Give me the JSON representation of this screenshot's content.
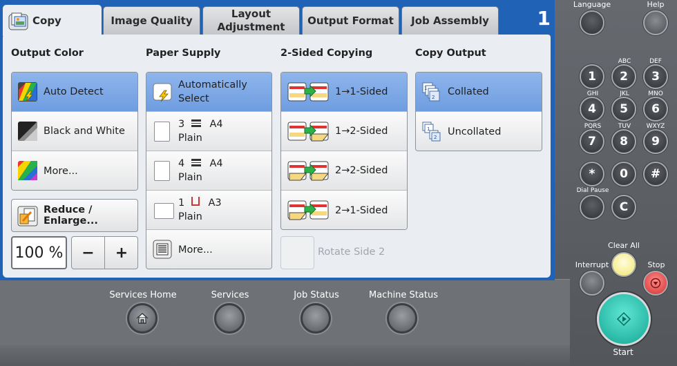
{
  "tabs": [
    {
      "label": "Copy",
      "active": true
    },
    {
      "label": "Image Quality"
    },
    {
      "label": "Layout\nAdjustment"
    },
    {
      "label": "Output Format"
    },
    {
      "label": "Job Assembly"
    }
  ],
  "page_number": "1",
  "output_color": {
    "heading": "Output Color",
    "options": [
      {
        "label": "Auto Detect",
        "icon": "auto-color-icon",
        "selected": true
      },
      {
        "label": "Black and White",
        "icon": "black-white-icon"
      },
      {
        "label": "More...",
        "icon": "color-more-icon"
      }
    ],
    "reduce_enlarge": "Reduce / Enlarge...",
    "zoom": "100 %",
    "minus": "−",
    "plus": "+"
  },
  "paper_supply": {
    "heading": "Paper Supply",
    "auto_line1": "Automatically",
    "auto_line2": "Select",
    "trays": [
      {
        "tray": "3",
        "size": "A4",
        "type": "Plain",
        "icon": "tray-icon"
      },
      {
        "tray": "4",
        "size": "A4",
        "type": "Plain",
        "icon": "tray-icon"
      },
      {
        "tray": "1",
        "size": "A3",
        "type": "Plain",
        "icon": "bypass-tray-icon"
      }
    ],
    "more": "More..."
  },
  "two_sided": {
    "heading": "2-Sided Copying",
    "options": [
      {
        "label": "1→1-Sided",
        "selected": true
      },
      {
        "label": "1→2-Sided"
      },
      {
        "label": "2→2-Sided"
      },
      {
        "label": "2→1-Sided"
      }
    ],
    "rotate": "Rotate Side 2"
  },
  "copy_output": {
    "heading": "Copy Output",
    "options": [
      {
        "label": "Collated",
        "selected": true
      },
      {
        "label": "Uncollated"
      }
    ]
  },
  "services": [
    {
      "label": "Services Home"
    },
    {
      "label": "Services"
    },
    {
      "label": "Job Status"
    },
    {
      "label": "Machine Status"
    }
  ],
  "hardware": {
    "language": "Language",
    "help": "Help",
    "keys": [
      {
        "key": "1",
        "letters": ""
      },
      {
        "key": "2",
        "letters": "ABC"
      },
      {
        "key": "3",
        "letters": "DEF"
      },
      {
        "key": "4",
        "letters": "GHI"
      },
      {
        "key": "5",
        "letters": "JKL"
      },
      {
        "key": "6",
        "letters": "MNO"
      },
      {
        "key": "7",
        "letters": "PQRS"
      },
      {
        "key": "8",
        "letters": "TUV"
      },
      {
        "key": "9",
        "letters": "WXYZ"
      },
      {
        "key": "*",
        "letters": ""
      },
      {
        "key": "0",
        "letters": ""
      },
      {
        "key": "#",
        "letters": ""
      }
    ],
    "dial_pause": "Dial Pause",
    "clear_key": "C",
    "clear_all": "Clear All",
    "interrupt": "Interrupt",
    "stop": "Stop",
    "start": "Start"
  },
  "colors": {
    "accent": "#1f62b6",
    "selected": "#7ea9e6",
    "start": "#2fc7b5",
    "clear_all": "#f7f1a0",
    "stop": "#e24a4a"
  }
}
